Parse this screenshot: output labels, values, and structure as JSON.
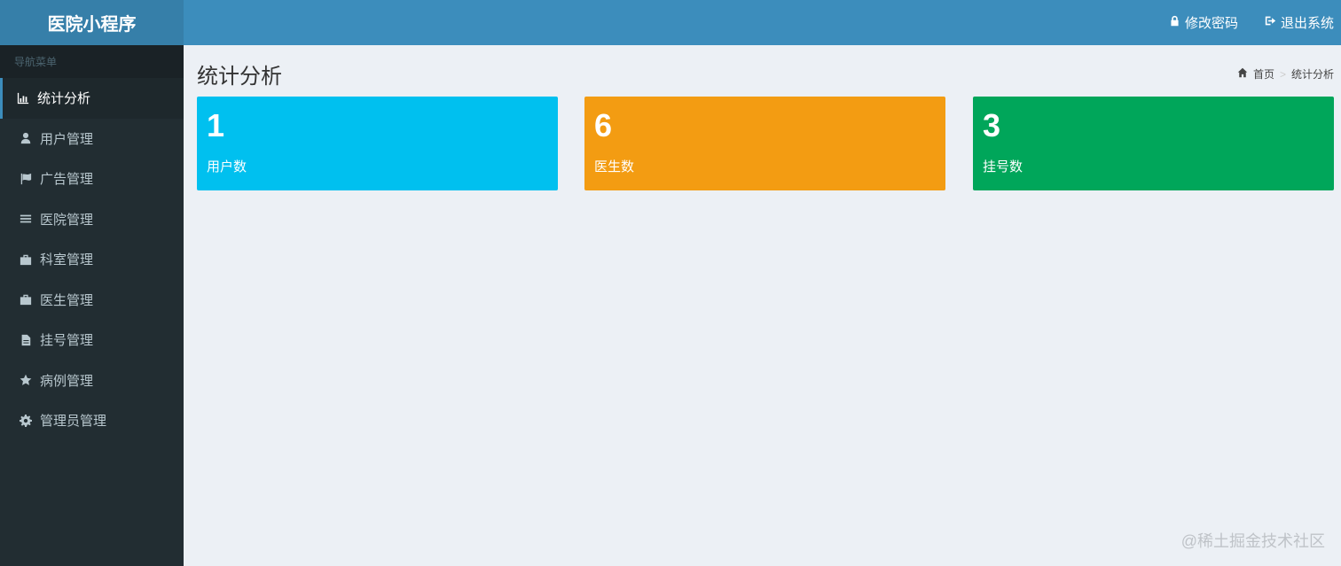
{
  "header": {
    "logo": "医院小程序",
    "actions": [
      {
        "label": "修改密码",
        "icon": "lock-icon"
      },
      {
        "label": "退出系统",
        "icon": "sign-out-icon"
      }
    ]
  },
  "sidebar": {
    "header": "导航菜单",
    "items": [
      {
        "label": "统计分析",
        "icon": "bar-chart-icon",
        "active": true
      },
      {
        "label": "用户管理",
        "icon": "user-icon"
      },
      {
        "label": "广告管理",
        "icon": "flag-icon"
      },
      {
        "label": "医院管理",
        "icon": "list-icon"
      },
      {
        "label": "科室管理",
        "icon": "briefcase-icon"
      },
      {
        "label": "医生管理",
        "icon": "briefcase-icon"
      },
      {
        "label": "挂号管理",
        "icon": "file-icon"
      },
      {
        "label": "病例管理",
        "icon": "star-icon"
      },
      {
        "label": "管理员管理",
        "icon": "gear-icon"
      }
    ]
  },
  "main": {
    "title": "统计分析",
    "breadcrumb": {
      "home": "首页",
      "separator": ">",
      "current": "统计分析"
    },
    "stats": [
      {
        "value": "1",
        "label": "用户数",
        "color": "#00c0ef"
      },
      {
        "value": "6",
        "label": "医生数",
        "color": "#f39c12"
      },
      {
        "value": "3",
        "label": "挂号数",
        "color": "#00a65a"
      }
    ]
  },
  "watermark": "@稀土掘金技术社区"
}
